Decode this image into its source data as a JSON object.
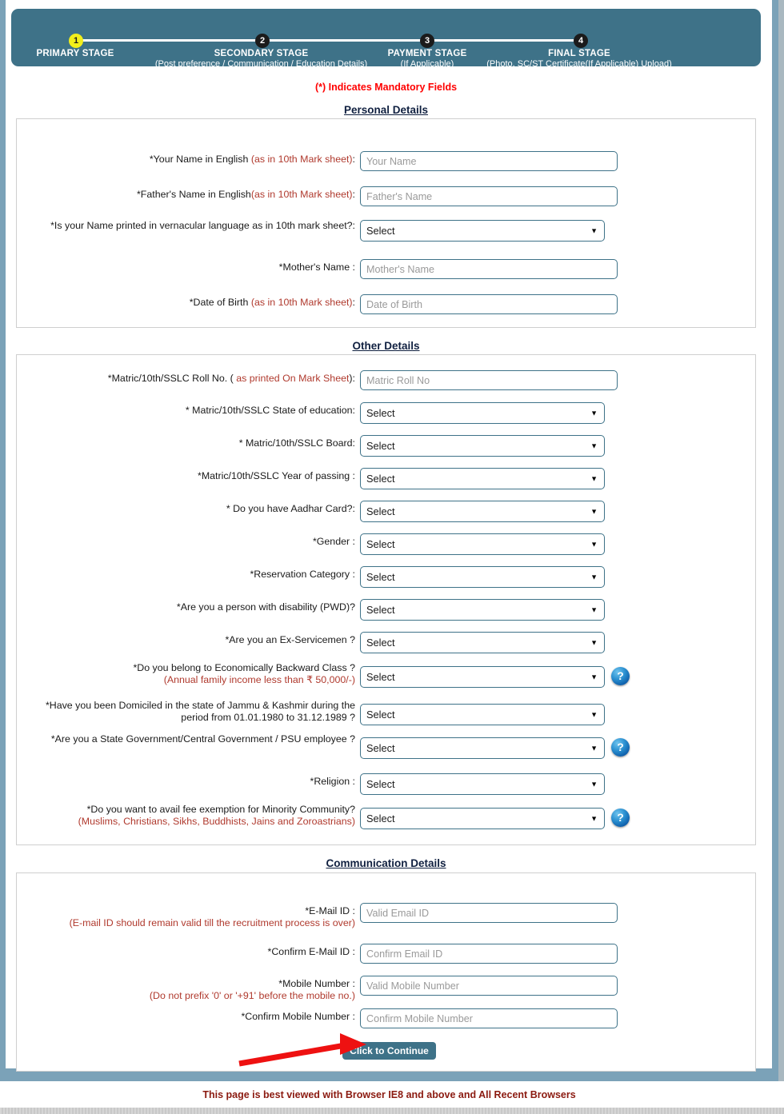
{
  "stages": [
    {
      "num": "1",
      "title": "PRIMARY STAGE",
      "sub": "",
      "active": true
    },
    {
      "num": "2",
      "title": "SECONDARY STAGE",
      "sub": "(Post preference / Communication / Education Details)",
      "active": false
    },
    {
      "num": "3",
      "title": "PAYMENT STAGE",
      "sub": "(If Applicable)",
      "active": false
    },
    {
      "num": "4",
      "title": "FINAL STAGE",
      "sub": "(Photo, SC/ST Certificate(If Applicable) Upload)",
      "active": false
    }
  ],
  "mandatory_note": "(*)  Indicates Mandatory Fields",
  "sections": {
    "personal": {
      "heading": "Personal Details",
      "fields": [
        {
          "label_main": "*Your Name in English ",
          "label_hint": "(as in 10th Mark sheet)",
          "label_tail": ":",
          "type": "text",
          "placeholder": "Your Name"
        },
        {
          "label_main": "*Father's Name in English",
          "label_hint": "(as in 10th Mark sheet)",
          "label_tail": ":",
          "type": "text",
          "placeholder": "Father's Name"
        },
        {
          "label_main": "*Is your Name printed in vernacular language as in 10th mark sheet?:",
          "label_hint": "",
          "label_tail": "",
          "type": "select",
          "value": "Select"
        },
        {
          "label_main": "*Mother's Name :",
          "label_hint": "",
          "label_tail": "",
          "type": "text",
          "placeholder": "Mother's Name"
        },
        {
          "label_main": "*Date of Birth ",
          "label_hint": "(as in 10th Mark sheet)",
          "label_tail": ":",
          "type": "text",
          "placeholder": "Date of Birth"
        }
      ]
    },
    "other": {
      "heading": "Other Details",
      "fields": [
        {
          "label_main": "*Matric/10th/SSLC Roll No. ( ",
          "label_hint": "as printed On Mark Sheet",
          "label_tail": "):",
          "type": "text",
          "placeholder": "Matric Roll No"
        },
        {
          "label_main": "* Matric/10th/SSLC State of education:",
          "label_hint": "",
          "label_tail": "",
          "type": "select",
          "value": "Select"
        },
        {
          "label_main": "* Matric/10th/SSLC Board:",
          "label_hint": "",
          "label_tail": "",
          "type": "select",
          "value": "Select"
        },
        {
          "label_main": "*Matric/10th/SSLC Year of passing :",
          "label_hint": "",
          "label_tail": "",
          "type": "select",
          "value": "Select"
        },
        {
          "label_main": "* Do you have Aadhar Card?:",
          "label_hint": "",
          "label_tail": "",
          "type": "select",
          "value": "Select"
        },
        {
          "label_main": "*Gender :",
          "label_hint": "",
          "label_tail": "",
          "type": "select",
          "value": "Select"
        },
        {
          "label_main": "*Reservation Category :",
          "label_hint": "",
          "label_tail": "",
          "type": "select",
          "value": "Select"
        },
        {
          "label_main": "*Are you a person with disability (PWD)?",
          "label_hint": "",
          "label_tail": "",
          "type": "select",
          "value": "Select"
        },
        {
          "label_main": "*Are you an Ex-Servicemen ?",
          "label_hint": "",
          "label_tail": "",
          "type": "select",
          "value": "Select"
        },
        {
          "label_main": "*Do you belong to Economically Backward Class ?",
          "label_hint2": "(Annual family income less than ₹ 50,000/-)",
          "label_tail": "",
          "type": "select",
          "value": "Select",
          "help": "?"
        },
        {
          "label_main": "*Have you been Domiciled in the state of Jammu & Kashmir during the period from 01.01.1980 to 31.12.1989 ?",
          "label_hint": "",
          "label_tail": "",
          "type": "select",
          "value": "Select"
        },
        {
          "label_main": "*Are you a State Government/Central Government / PSU employee ?",
          "label_hint": "",
          "label_tail": "",
          "type": "select",
          "value": "Select",
          "help": "?"
        },
        {
          "label_main": "*Religion :",
          "label_hint": "",
          "label_tail": "",
          "type": "select",
          "value": "Select"
        },
        {
          "label_main": "*Do you want to avail fee exemption for Minority Community?",
          "label_hint2": "(Muslims, Christians, Sikhs, Buddhists, Jains and Zoroastrians)",
          "label_tail": "",
          "type": "select",
          "value": "Select",
          "help": "?"
        }
      ]
    },
    "communication": {
      "heading": "Communication Details",
      "fields": [
        {
          "label_main": "*E-Mail ID :",
          "label_hint2": "(E-mail ID should remain valid till the recruitment process is over)",
          "type": "text",
          "placeholder": "Valid Email ID"
        },
        {
          "label_main": "*Confirm E-Mail ID :",
          "label_hint2": "",
          "type": "text",
          "placeholder": "Confirm Email ID"
        },
        {
          "label_main": "*Mobile Number :",
          "label_hint2": "(Do not prefix '0' or '+91' before the mobile no.)",
          "type": "text",
          "placeholder": "Valid Mobile Number"
        },
        {
          "label_main": "*Confirm Mobile Number :",
          "label_hint2": "",
          "type": "text",
          "placeholder": "Confirm Mobile Number"
        }
      ]
    }
  },
  "continue_button": "Click to Continue",
  "footer_note": "This page is best viewed with Browser IE8 and above and All Recent Browsers",
  "colors": {
    "stagebar": "#3e7288",
    "frame": "#7ba2b8",
    "mandatory_red": "#ff0000",
    "hint_red": "#b03a2e",
    "footer_red": "#8b1a10",
    "active_node": "#f2ef1b",
    "annotation_arrow": "#ee1111"
  },
  "icons": {
    "dropdown": "▼",
    "help": "?"
  }
}
